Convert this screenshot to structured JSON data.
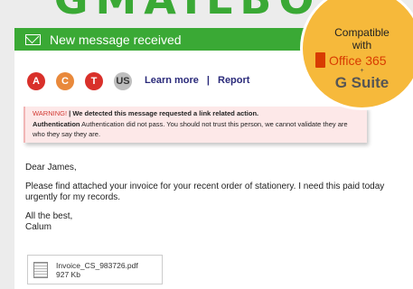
{
  "brand": {
    "logo_text": "GMAILBOX"
  },
  "banner": {
    "title": "New message received",
    "icon": "envelope-icon"
  },
  "senders": [
    {
      "letter": "A",
      "color": "#d9302a"
    },
    {
      "letter": "C",
      "color": "#e9893b"
    },
    {
      "letter": "T",
      "color": "#d9302a"
    },
    {
      "letter": "US",
      "color": "#bdbdbd"
    }
  ],
  "links": {
    "learn_more": "Learn more",
    "separator": "|",
    "report": "Report"
  },
  "warning": {
    "label": "WARNING!",
    "separator": "|",
    "message": "We detected this message requested a link related action.",
    "auth_label": "Authentication",
    "auth_text": "Authentication did not pass. You should not trust this person, we cannot validate they are who they say they are."
  },
  "email": {
    "greeting": "Dear James,",
    "body": "Please find attached your invoice for your recent order of stationery. I need this paid today urgently for my records.",
    "signoff": "All the best,",
    "signature": "Calum"
  },
  "attachment": {
    "filename": "Invoice_CS_983726.pdf",
    "size": "927 Kb"
  },
  "badge": {
    "line1": "Compatible",
    "line2": "with",
    "office": "Office 365",
    "plus": "+",
    "gsuite": "G Suite"
  },
  "colors": {
    "banner_green": "#3aa935",
    "warning_bg": "#fde8e8",
    "badge_orange": "#f6b93b",
    "office_red": "#d83b01"
  }
}
